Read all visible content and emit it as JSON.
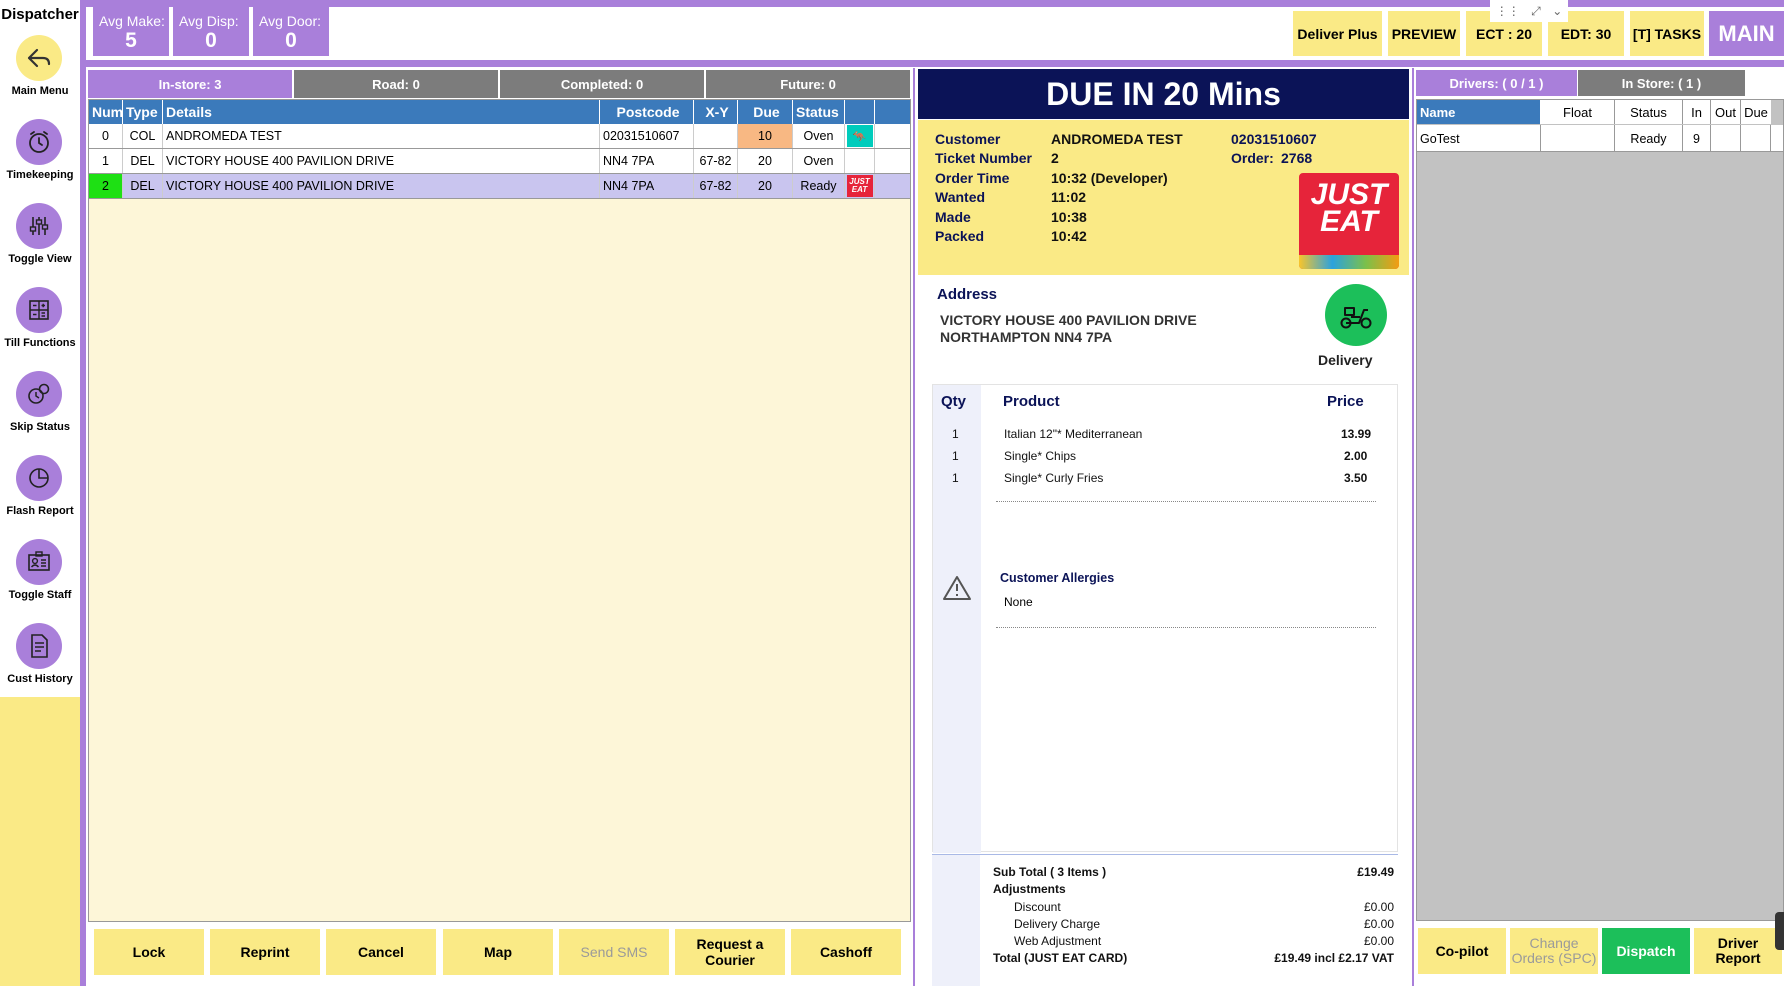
{
  "sidebar": {
    "title": "Dispatcher",
    "items": [
      {
        "label": "Main Menu",
        "icon": "back-arrow-icon"
      },
      {
        "label": "Timekeeping",
        "icon": "clock-icon"
      },
      {
        "label": "Toggle View",
        "icon": "sliders-icon"
      },
      {
        "label": "Till Functions",
        "icon": "calculator-icon"
      },
      {
        "label": "Skip Status",
        "icon": "skip-icon"
      },
      {
        "label": "Flash Report",
        "icon": "pie-chart-icon"
      },
      {
        "label": "Toggle Staff",
        "icon": "id-card-icon"
      },
      {
        "label": "Cust History",
        "icon": "document-icon"
      }
    ]
  },
  "stats": [
    {
      "label": "Avg Make:",
      "value": "5"
    },
    {
      "label": "Avg Disp:",
      "value": "0"
    },
    {
      "label": "Avg Door:",
      "value": "0"
    }
  ],
  "toolbar": {
    "deliver_plus": "Deliver Plus",
    "preview": "PREVIEW",
    "ect": "ECT : 20",
    "edt": "EDT: 30",
    "tasks": "[T] TASKS",
    "main": "MAIN"
  },
  "order_tabs": [
    "In-store: 3",
    "Road: 0",
    "Completed: 0",
    "Future: 0"
  ],
  "orders": {
    "columns": [
      "Num",
      "Type",
      "Details",
      "Postcode",
      "X-Y",
      "Due",
      "Status"
    ],
    "rows": [
      {
        "num": "0",
        "type": "COL",
        "details": "ANDROMEDA TEST",
        "postcode": "02031510607",
        "xy": "",
        "due": "10",
        "status": "Oven",
        "source": "deliveroo"
      },
      {
        "num": "1",
        "type": "DEL",
        "details": "VICTORY HOUSE 400 PAVILION DRIVE",
        "postcode": "NN4 7PA",
        "xy": "67-82",
        "due": "20",
        "status": "Oven",
        "source": ""
      },
      {
        "num": "2",
        "type": "DEL",
        "details": "VICTORY HOUSE 400 PAVILION DRIVE",
        "postcode": "NN4 7PA",
        "xy": "67-82",
        "due": "20",
        "status": "Ready",
        "source": "just-eat"
      }
    ],
    "source_logos": {
      "deliveroo": "deliveroo",
      "just_eat": "JUST EAT"
    }
  },
  "actions": [
    "Lock",
    "Reprint",
    "Cancel",
    "Map",
    "Send SMS",
    "Request a Courier",
    "Cashoff"
  ],
  "detail": {
    "due_banner": "DUE IN 20 Mins",
    "labels": {
      "customer": "Customer",
      "ticket": "Ticket Number",
      "order_time": "Order Time",
      "wanted": "Wanted",
      "made": "Made",
      "packed": "Packed"
    },
    "customer": "ANDROMEDA TEST",
    "phone": "02031510607",
    "order_label": "Order:",
    "order_no": "2768",
    "ticket": "2",
    "order_time": "10:32 (Developer)",
    "wanted": "11:02",
    "made": "10:38",
    "packed": "10:42",
    "brand_logo": "JUST EAT",
    "address_heading": "Address",
    "address_line1": "VICTORY HOUSE 400 PAVILION DRIVE",
    "address_line2": "NORTHAMPTON NN4 7PA",
    "delivery_label": "Delivery",
    "item_headers": {
      "qty": "Qty",
      "product": "Product",
      "price": "Price"
    },
    "items": [
      {
        "qty": "1",
        "product": "Italian 12\"* Mediterranean",
        "price": "13.99"
      },
      {
        "qty": "1",
        "product": "Single* Chips",
        "price": "2.00"
      },
      {
        "qty": "1",
        "product": "Single* Curly Fries",
        "price": "3.50"
      }
    ],
    "allergies_heading": "Customer Allergies",
    "allergies": "None",
    "totals": {
      "subtotal_label": "Sub Total  ( 3 Items )",
      "subtotal": "£19.49",
      "adjustments_label": "Adjustments",
      "discount_label": "Discount",
      "discount": "£0.00",
      "delivery_label": "Delivery Charge",
      "delivery": "£0.00",
      "web_label": "Web Adjustment",
      "web": "£0.00",
      "total_label": "Total (JUST EAT CARD)",
      "total": "£19.49 incl £2.17 VAT"
    }
  },
  "drivers": {
    "tabs": [
      "Drivers: ( 0 / 1 )",
      "In Store: ( 1 )"
    ],
    "columns": [
      "Name",
      "Float",
      "Status",
      "In",
      "Out",
      "Due"
    ],
    "rows": [
      {
        "name": "GoTest",
        "float": "",
        "status": "Ready",
        "in": "9",
        "out": "",
        "due": ""
      }
    ]
  },
  "driver_actions": [
    "Co-pilot",
    "Change Orders (SPC)",
    "Dispatch",
    "Driver Report"
  ],
  "colors": {
    "accent": "#a97fda",
    "yellow": "#faea86",
    "header_blue": "#3b7abb",
    "navy": "#0b1357",
    "green": "#1cbf5a",
    "just_eat_red": "#e6243a"
  }
}
